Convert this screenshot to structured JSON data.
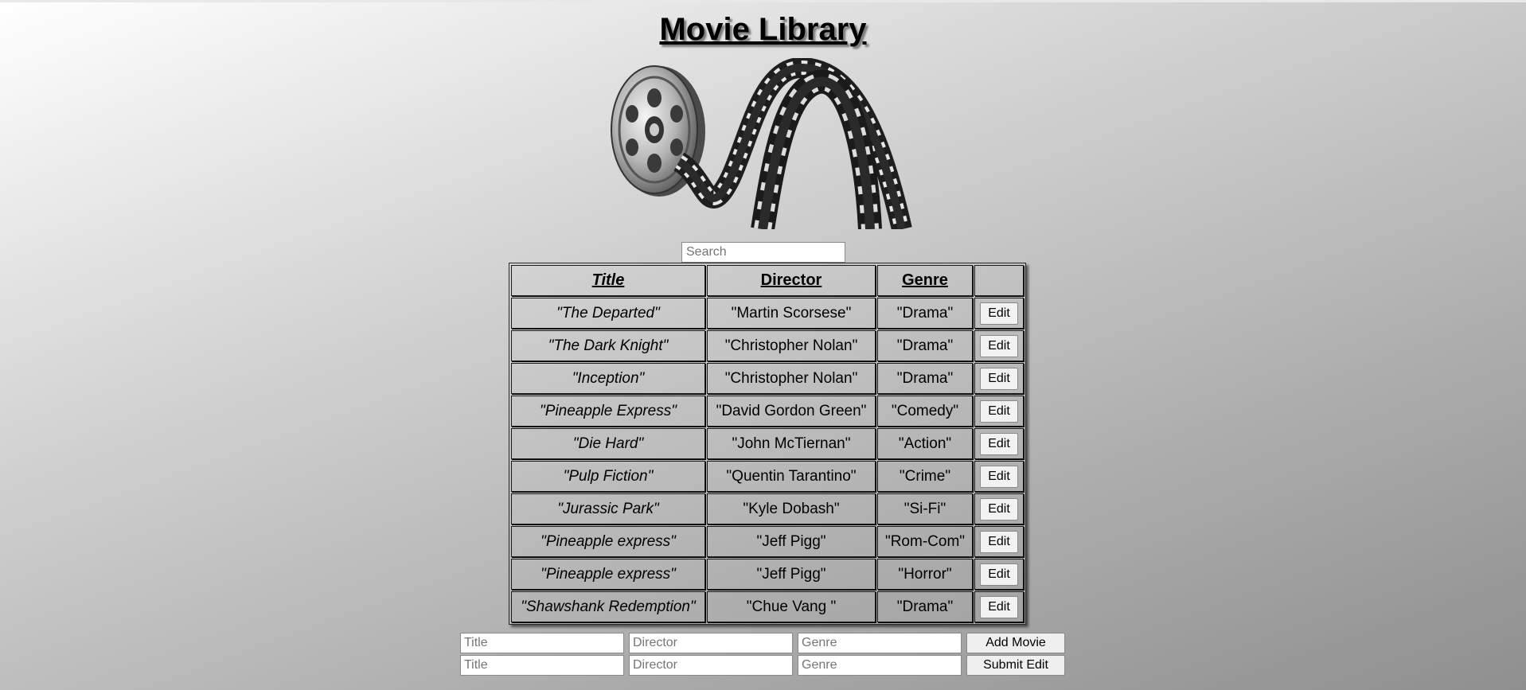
{
  "header": {
    "title": "Movie Library"
  },
  "logo": {
    "icon": "film-reel-icon"
  },
  "search": {
    "placeholder": "Search",
    "value": ""
  },
  "table": {
    "columns": [
      "Title",
      "Director",
      "Genre",
      ""
    ],
    "edit_label": "Edit",
    "rows": [
      {
        "title": "\"The Departed\"",
        "director": "\"Martin Scorsese\"",
        "genre": "\"Drama\""
      },
      {
        "title": "\"The Dark Knight\"",
        "director": "\"Christopher Nolan\"",
        "genre": "\"Drama\""
      },
      {
        "title": "\"Inception\"",
        "director": "\"Christopher Nolan\"",
        "genre": "\"Drama\""
      },
      {
        "title": "\"Pineapple Express\"",
        "director": "\"David Gordon Green\"",
        "genre": "\"Comedy\""
      },
      {
        "title": "\"Die Hard\"",
        "director": "\"John McTiernan\"",
        "genre": "\"Action\""
      },
      {
        "title": "\"Pulp Fiction\"",
        "director": "\"Quentin Tarantino\"",
        "genre": "\"Crime\""
      },
      {
        "title": "\"Jurassic Park\"",
        "director": "\"Kyle Dobash\"",
        "genre": "\"Si-Fi\""
      },
      {
        "title": "\"Pineapple express\"",
        "director": "\"Jeff Pigg\"",
        "genre": "\"Rom-Com\""
      },
      {
        "title": "\"Pineapple express\"",
        "director": "\"Jeff Pigg\"",
        "genre": "\"Horror\""
      },
      {
        "title": "\"Shawshank Redemption\"",
        "director": "\"Chue Vang \"",
        "genre": "\"Drama\""
      }
    ]
  },
  "add_form": {
    "title_placeholder": "Title",
    "director_placeholder": "Director",
    "genre_placeholder": "Genre",
    "button_label": "Add Movie"
  },
  "edit_form": {
    "title_placeholder": "Title",
    "director_placeholder": "Director",
    "genre_placeholder": "Genre",
    "button_label": "Submit Edit"
  }
}
